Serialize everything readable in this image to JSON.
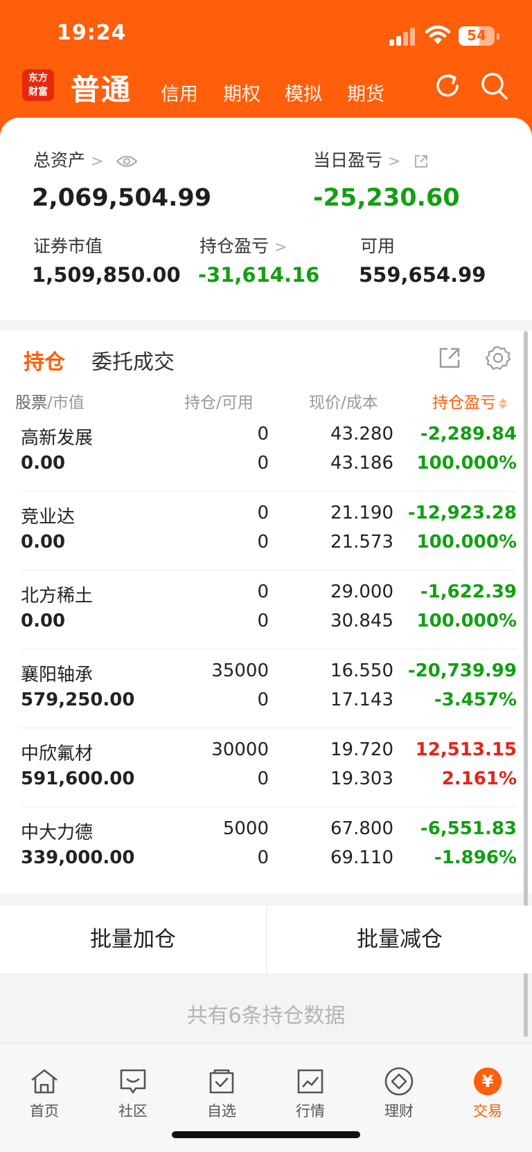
{
  "status_bar": {
    "time": "19:24",
    "battery": "54"
  },
  "nav": {
    "logo_line1": "东方",
    "logo_line2": "财富",
    "active_tab": "普通",
    "tabs": [
      "信用",
      "期权",
      "模拟",
      "期货"
    ]
  },
  "summary": {
    "total_assets_label": "总资产",
    "total_assets_value": "2,069,504.99",
    "daily_pl_label": "当日盈亏",
    "daily_pl_value": "-25,230.60",
    "market_value_label": "证券市值",
    "market_value": "1,509,850.00",
    "position_pl_label": "持仓盈亏",
    "position_pl": "-31,614.16",
    "available_label": "可用",
    "available": "559,654.99"
  },
  "holdings_tabs": {
    "active": "持仓",
    "other": "委托成交"
  },
  "table_headers": {
    "stock": "股票",
    "market_value": "市值",
    "position": "持仓",
    "available": "可用",
    "price": "现价",
    "cost": "成本",
    "pl": "持仓盈亏"
  },
  "holdings": [
    {
      "name": "高新发展",
      "market_value": "0.00",
      "qty": "0",
      "avail": "0",
      "price": "43.280",
      "cost": "43.186",
      "pl": "-2,289.84",
      "pct": "100.000%",
      "trend": "loss"
    },
    {
      "name": "竞业达",
      "market_value": "0.00",
      "qty": "0",
      "avail": "0",
      "price": "21.190",
      "cost": "21.573",
      "pl": "-12,923.28",
      "pct": "100.000%",
      "trend": "loss"
    },
    {
      "name": "北方稀土",
      "market_value": "0.00",
      "qty": "0",
      "avail": "0",
      "price": "29.000",
      "cost": "30.845",
      "pl": "-1,622.39",
      "pct": "100.000%",
      "trend": "loss"
    },
    {
      "name": "襄阳轴承",
      "market_value": "579,250.00",
      "qty": "35000",
      "avail": "0",
      "price": "16.550",
      "cost": "17.143",
      "pl": "-20,739.99",
      "pct": "-3.457%",
      "trend": "loss"
    },
    {
      "name": "中欣氟材",
      "market_value": "591,600.00",
      "qty": "30000",
      "avail": "0",
      "price": "19.720",
      "cost": "19.303",
      "pl": "12,513.15",
      "pct": "2.161%",
      "trend": "gain"
    },
    {
      "name": "中大力德",
      "market_value": "339,000.00",
      "qty": "5000",
      "avail": "0",
      "price": "67.800",
      "cost": "69.110",
      "pl": "-6,551.83",
      "pct": "-1.896%",
      "trend": "loss"
    }
  ],
  "batch": {
    "add": "批量加仓",
    "reduce": "批量减仓"
  },
  "footer_count": "共有6条持仓数据",
  "bottom_nav": [
    "首页",
    "社区",
    "自选",
    "行情",
    "理财",
    "交易"
  ],
  "colors": {
    "brand_orange": "#ff5e0a",
    "gain_red": "#e1251b",
    "loss_green": "#10a010"
  }
}
